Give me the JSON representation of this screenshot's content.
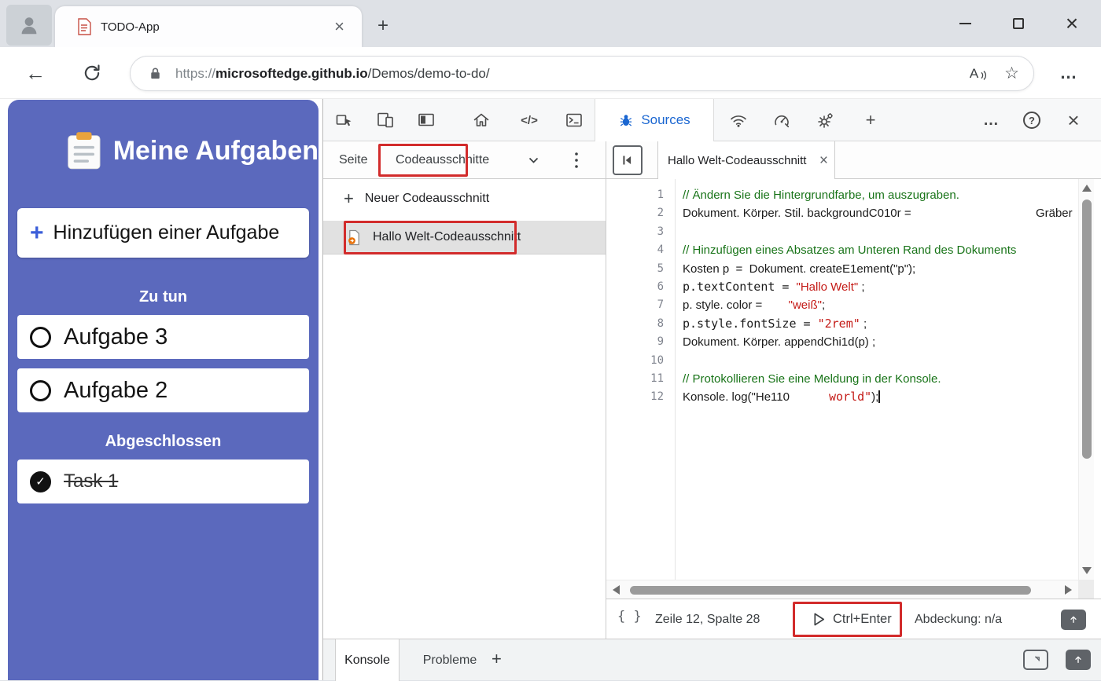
{
  "browser": {
    "tab_title": "TODO-App",
    "url_prefix": "https://",
    "url_domain": "microsoftedge.github.io",
    "url_path": "/Demos/demo-to-do/"
  },
  "todo_app": {
    "title": "Meine Aufgaben",
    "add_task_label": "Hinzufügen einer Aufgabe",
    "todo_section_label": "Zu tun",
    "done_section_label": "Abgeschlossen",
    "tasks_todo": [
      "Aufgabe 3",
      "Aufgabe 2"
    ],
    "tasks_done": [
      "Task 1"
    ]
  },
  "devtools": {
    "toolbar": {
      "sources_tab_label": "Sources"
    },
    "navigator": {
      "page_tab_label": "Seite",
      "snippets_tab_label": "Codeausschnitte",
      "new_snippet_label": "Neuer Codeausschnitt",
      "snippet_item_label": "Hallo Welt-Codeausschnitt"
    },
    "editor": {
      "tab_label": "Hallo Welt-Codeausschnitt",
      "lines": [
        {
          "n": "1",
          "segs": [
            {
              "c": "comment",
              "t": "// Ändern Sie die Hintergrundfarbe, um auszugraben."
            }
          ]
        },
        {
          "n": "2",
          "segs": [
            {
              "c": "code",
              "t": "Dokument. Körper. Stil. backgroundC010r ="
            },
            {
              "c": "code",
              "t": "                                      Gräber"
            }
          ]
        },
        {
          "n": "3",
          "segs": []
        },
        {
          "n": "4",
          "segs": [
            {
              "c": "comment",
              "t": "// Hinzufügen eines Absatzes am Unteren Rand des Dokuments"
            }
          ]
        },
        {
          "n": "5",
          "segs": [
            {
              "c": "code",
              "t": "Kosten p  =  Dokument. createE1ement(\"p\");"
            }
          ]
        },
        {
          "n": "6",
          "segs": [
            {
              "c": "mono",
              "t": "p.textContent = "
            },
            {
              "c": "str-sans",
              "t": "\"Hallo Welt\""
            },
            {
              "c": "code",
              "t": " ;"
            }
          ]
        },
        {
          "n": "7",
          "segs": [
            {
              "c": "code",
              "t": "p. style. color =        "
            },
            {
              "c": "str-sans",
              "t": "\"weiß\""
            },
            {
              "c": "code",
              "t": ";"
            }
          ]
        },
        {
          "n": "8",
          "segs": [
            {
              "c": "mono",
              "t": "p.style.fontSize = "
            },
            {
              "c": "str-mono",
              "t": "\"2rem\""
            },
            {
              "c": "code",
              "t": " ;"
            }
          ]
        },
        {
          "n": "9",
          "segs": [
            {
              "c": "code",
              "t": "Dokument. Körper. appendChi1d(p) ;"
            }
          ]
        },
        {
          "n": "10",
          "segs": []
        },
        {
          "n": "11",
          "segs": [
            {
              "c": "comment",
              "t": "// Protokollieren Sie eine Meldung in der Konsole."
            }
          ]
        },
        {
          "n": "12",
          "segs": [
            {
              "c": "code",
              "t": "Konsole. log(\"He110            "
            },
            {
              "c": "str-mono",
              "t": "world\""
            },
            {
              "c": "code",
              "t": ");"
            }
          ],
          "caret": true
        }
      ]
    },
    "statusbar": {
      "cursor_position": "Zeile 12, Spalte 28",
      "run_shortcut_label": "Ctrl+Enter",
      "coverage_label": "Abdeckung: n/a"
    },
    "drawer": {
      "console_tab_label": "Konsole",
      "problems_tab_label": "Probleme"
    }
  },
  "icons": {
    "back_arrow": "←",
    "plus": "+",
    "close": "×",
    "more": "…",
    "help": "?",
    "star": "☆",
    "elements": "</>",
    "braces": "{ }",
    "check": "✓",
    "read_aloud": "A"
  },
  "colors": {
    "todo_background": "#5b69bd",
    "annotation_red": "#d22b2b",
    "accent_blue": "#1a66d1",
    "comment_green": "#197419",
    "string_red": "#c41a16"
  }
}
